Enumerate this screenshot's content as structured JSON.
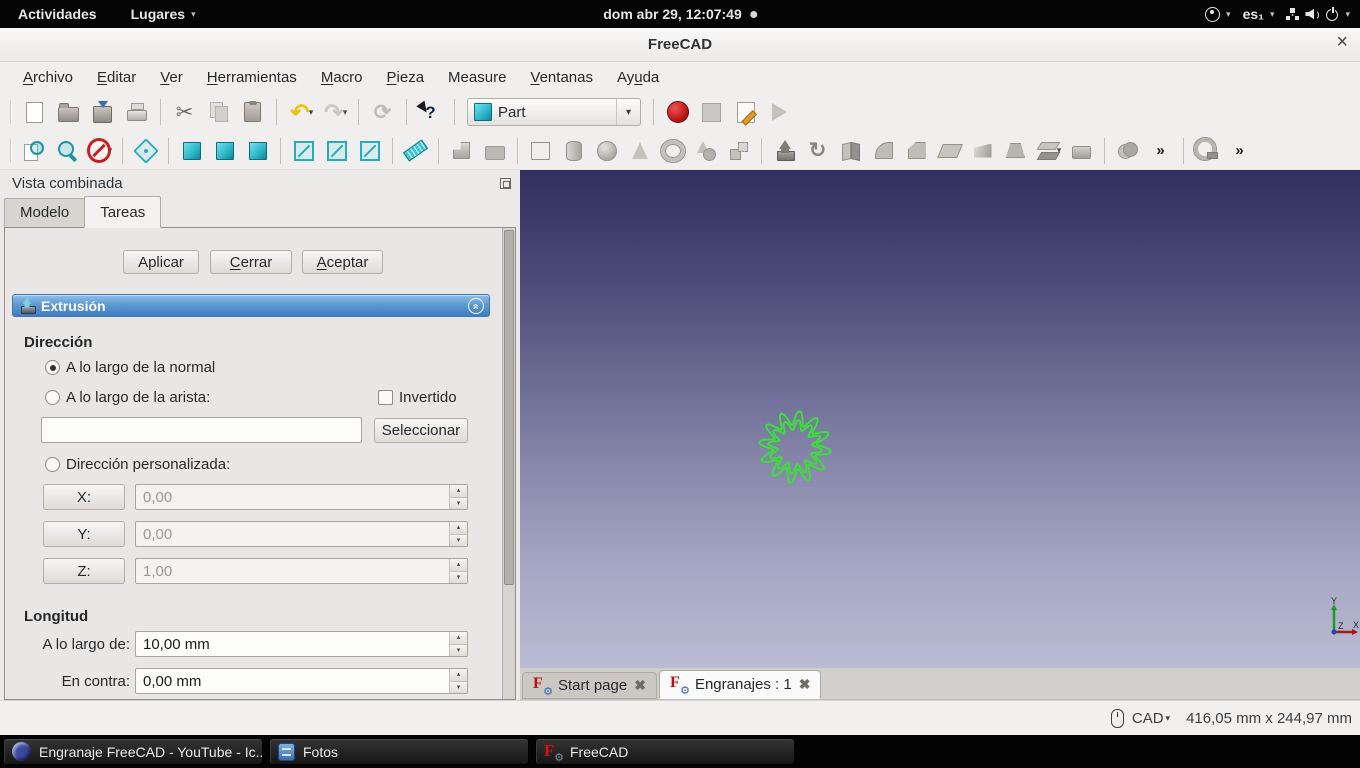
{
  "glyphs": {
    "dropdown": "▾",
    "scissors": "✂",
    "undo": "↶",
    "redo": "↷",
    "refresh": "⟳",
    "whatsthis": "?",
    "revolve": "↻",
    "chevrons": "»",
    "gear": "⚙",
    "close_x": "✖",
    "up": "▴",
    "down": "▾",
    "collapse": "«",
    "freecad_f": "F"
  },
  "topbar": {
    "activities": "Actividades",
    "places": "Lugares",
    "clock": "dom abr 29, 12:07:49",
    "keyboard": "es₁"
  },
  "window": {
    "title": "FreeCAD",
    "close": "×"
  },
  "menus": [
    {
      "label": "Archivo",
      "u": 0
    },
    {
      "label": "Editar",
      "u": 0
    },
    {
      "label": "Ver",
      "u": 0
    },
    {
      "label": "Herramientas",
      "u": 0
    },
    {
      "label": "Macro",
      "u": 0
    },
    {
      "label": "Pieza",
      "u": 0
    },
    {
      "label": "Measure",
      "u": -1
    },
    {
      "label": "Ventanas",
      "u": 0
    },
    {
      "label": "Ayuda",
      "u": 2
    }
  ],
  "toolbar": {
    "workbench": "Part",
    "row1a": [
      {
        "name": "new-file",
        "cls": "i-page"
      },
      {
        "name": "open-file",
        "cls": "i-folder"
      },
      {
        "name": "save-file",
        "cls": "i-save"
      },
      {
        "name": "print",
        "cls": "i-print",
        "disabled": true
      },
      {
        "sep": true
      },
      {
        "name": "cut",
        "cls": "i-cut",
        "glyph": "scissors"
      },
      {
        "name": "copy",
        "cls": "i-copy",
        "disabled": true
      },
      {
        "name": "paste",
        "cls": "i-paste"
      },
      {
        "sep": true
      },
      {
        "name": "undo",
        "cls": "i-undo",
        "glyph": "undo",
        "dd": true
      },
      {
        "name": "redo",
        "cls": "i-redo",
        "glyph": "redo",
        "dd": true,
        "disabled": true
      },
      {
        "sep": true
      },
      {
        "name": "refresh",
        "cls": "i-refresh",
        "glyph": "refresh",
        "disabled": true
      },
      {
        "sep": true
      },
      {
        "name": "whats-this",
        "cls": "i-whatsthis",
        "glyph": "whatsthis"
      },
      {
        "sep": true
      }
    ],
    "row1b": [
      {
        "sep": true
      },
      {
        "name": "record-macro",
        "cls": "i-record"
      },
      {
        "name": "stop-macro",
        "cls": "i-stop",
        "disabled": true
      },
      {
        "name": "edit-macros",
        "cls": "i-macroedit"
      },
      {
        "name": "run-macro",
        "cls": "i-play",
        "disabled": true
      }
    ],
    "row2": [
      {
        "name": "fit-all",
        "cls": "i-fitall"
      },
      {
        "name": "zoom-box",
        "cls": "i-zoombox"
      },
      {
        "name": "draw-style",
        "cls": "i-nosign",
        "dd": true
      },
      {
        "sep": true
      },
      {
        "name": "view-axonometric",
        "cls": "i-axo"
      },
      {
        "sep": true
      },
      {
        "name": "view-front",
        "cls": "i-cubesolid"
      },
      {
        "name": "view-top",
        "cls": "i-cubesolid"
      },
      {
        "name": "view-right",
        "cls": "i-cubesolid"
      },
      {
        "sep": true
      },
      {
        "name": "view-rear",
        "cls": "i-cubewire"
      },
      {
        "name": "view-bottom",
        "cls": "i-cubewire"
      },
      {
        "name": "view-left",
        "cls": "i-cubewire"
      },
      {
        "sep": true
      },
      {
        "name": "measure-linear",
        "cls": "i-ruler"
      },
      {
        "sep": true
      },
      {
        "name": "part-document",
        "cls": "i-graypart",
        "disabled": true
      },
      {
        "name": "group",
        "cls": "i-gfold",
        "disabled": true
      },
      {
        "sep": true
      },
      {
        "name": "part-box",
        "cls": "i-gbox",
        "disabled": true
      },
      {
        "name": "part-cylinder",
        "cls": "i-gcyl",
        "disabled": true
      },
      {
        "name": "part-sphere",
        "cls": "i-gsphere",
        "disabled": true
      },
      {
        "name": "part-cone",
        "cls": "i-gcone",
        "disabled": true
      },
      {
        "name": "part-torus",
        "cls": "i-gtorus",
        "disabled": true
      },
      {
        "name": "part-primitives",
        "cls": "i-gprims",
        "disabled": true
      },
      {
        "name": "shape-builder",
        "cls": "i-gbuild",
        "disabled": true
      },
      {
        "sep": true
      },
      {
        "name": "part-extrude",
        "cls": "i-gextrude"
      },
      {
        "name": "part-revolve",
        "cls": "i-grevolve",
        "glyph": "revolve"
      },
      {
        "name": "part-mirror",
        "cls": "i-gmirror",
        "disabled": true
      },
      {
        "name": "part-fillet",
        "cls": "i-gfillet",
        "disabled": true
      },
      {
        "name": "part-chamfer",
        "cls": "i-gchamfer",
        "disabled": true
      },
      {
        "name": "part-make-face",
        "cls": "i-gface",
        "disabled": true
      },
      {
        "name": "part-ruled-surface",
        "cls": "i-gruled",
        "disabled": true
      },
      {
        "name": "part-loft",
        "cls": "i-gloft",
        "disabled": true
      },
      {
        "name": "part-offset",
        "cls": "i-goffset",
        "dd": true,
        "disabled": true
      },
      {
        "name": "part-thickness",
        "cls": "i-gthick",
        "disabled": true
      },
      {
        "sep": true
      },
      {
        "name": "part-boolean",
        "cls": "i-gbool",
        "disabled": true
      },
      {
        "name": "toolbar-overflow-part",
        "cls": "i-chev",
        "glyph": "chevrons"
      },
      {
        "sep": true
      },
      {
        "name": "measure-tape",
        "cls": "i-gtape",
        "disabled": true
      },
      {
        "name": "toolbar-overflow-measure",
        "cls": "i-chev",
        "glyph": "chevrons"
      }
    ]
  },
  "combined_view": {
    "title": "Vista combinada",
    "tabs": [
      {
        "label": "Modelo",
        "active": false
      },
      {
        "label": "Tareas",
        "active": true
      }
    ]
  },
  "task": {
    "buttons": {
      "apply": {
        "label": "Aplicar",
        "u": -1
      },
      "close": {
        "label": "Cerrar",
        "u": 0
      },
      "ok": {
        "label": "Aceptar",
        "u": 0
      }
    },
    "section_title": "Extrusión",
    "direction": {
      "heading": "Dirección",
      "along_normal": "A lo largo de la normal",
      "along_edge": "A lo largo de la arista:",
      "inverted": "Invertido",
      "edge_value": "",
      "select_button": {
        "label": "Seleccionar",
        "u": -1
      },
      "custom": "Dirección personalizada:",
      "x_label": "X:",
      "x_value": "0,00",
      "y_label": "Y:",
      "y_value": "0,00",
      "z_label": "Z:",
      "z_value": "1,00"
    },
    "length": {
      "heading": "Longitud",
      "along_label": "A lo largo de:",
      "along_value": "10,00 mm",
      "against_label": "En contra:",
      "against_value": "0,00 mm"
    }
  },
  "viewport": {
    "tabs": [
      {
        "label": "Start page",
        "active": false
      },
      {
        "label": "Engranajes : 1",
        "active": true
      }
    ],
    "axis": {
      "x": "X",
      "y": "Y",
      "z": "Z"
    },
    "gear": {
      "teeth": 12,
      "rings": [
        {
          "r": 29,
          "a": 7
        },
        {
          "r": 22,
          "a": 5
        }
      ],
      "color": "#3fdc3f"
    }
  },
  "statusbar": {
    "nav_style": "CAD",
    "dimensions": "416,05 mm x 244,97 mm"
  },
  "taskbar": {
    "windows": [
      {
        "label": "Engranaje FreeCAD - YouTube - Ic...",
        "icon": "browser"
      },
      {
        "label": "Fotos",
        "icon": "photos"
      },
      {
        "label": "FreeCAD",
        "icon": "freecad"
      }
    ]
  },
  "colors": {
    "accent_header_top": "#8fc0ea",
    "accent_header_bottom": "#3f7cc0",
    "viewport_top": "#31305f",
    "viewport_bottom": "#b9bbd3",
    "gear_green": "#3fdc3f",
    "record_red": "#b11212",
    "cube_teal": "#2fb9cc"
  }
}
